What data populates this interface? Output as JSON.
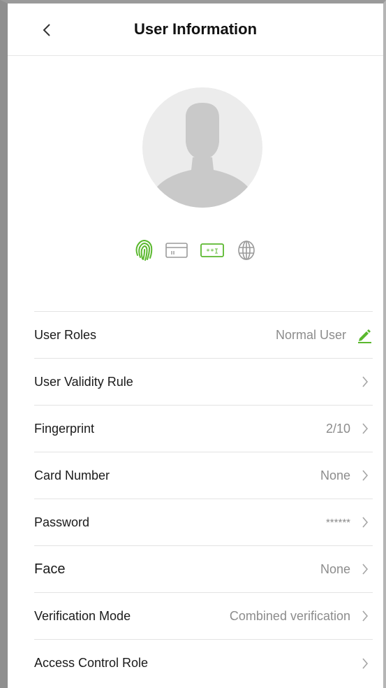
{
  "header": {
    "title": "User Information",
    "back_icon": "chevron-left-icon"
  },
  "avatar": {
    "icon": "user-silhouette-icon"
  },
  "verification_icons": [
    "fingerprint-icon",
    "card-icon",
    "password-icon",
    "face-icon"
  ],
  "colors": {
    "accent": "#5ab82e",
    "muted_icon": "#9a9a9a",
    "text": "#1a1a1a",
    "value_text": "#8c8c8c",
    "divider": "#e3e3e3",
    "avatar_bg": "#ececec",
    "avatar_fg": "#c9c9c9"
  },
  "rows": [
    {
      "label": "User Roles",
      "value": "Normal User",
      "trailing": "edit-icon"
    },
    {
      "label": "User Validity Rule",
      "value": "",
      "trailing": "chevron-right-icon"
    },
    {
      "label": "Fingerprint",
      "value": "2/10",
      "trailing": "chevron-right-icon"
    },
    {
      "label": "Card Number",
      "value": "None",
      "trailing": "chevron-right-icon"
    },
    {
      "label": "Password",
      "value": "******",
      "trailing": "chevron-right-icon"
    },
    {
      "label": "Face",
      "value": "None",
      "trailing": "chevron-right-icon"
    },
    {
      "label": "Verification Mode",
      "value": "Combined verification",
      "trailing": "chevron-right-icon"
    },
    {
      "label": "Access Control Role",
      "value": "",
      "trailing": "chevron-right-icon"
    }
  ]
}
